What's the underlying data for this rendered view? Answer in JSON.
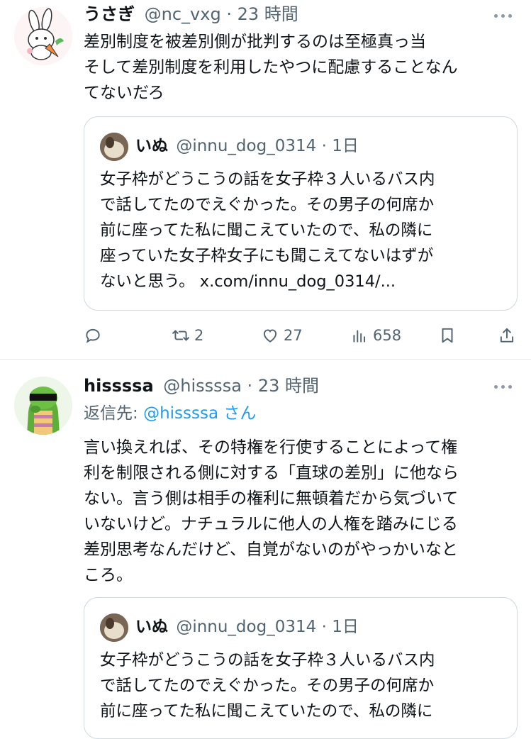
{
  "tweets": [
    {
      "author": {
        "name": "うさぎ",
        "handle": "@nc_vxg",
        "time": "23 時間"
      },
      "separator": "·",
      "text_lines": [
        "差別制度を被差別側が批判するのは至極真っ当",
        "そして差別制度を利用したやつに配慮することなん",
        "てないだろ"
      ],
      "quote": {
        "author": {
          "name": "いぬ",
          "handle": "@innu_dog_0314",
          "time": "1日"
        },
        "text_lines": [
          "女子枠がどうこうの話を女子枠３人いるバス内",
          "で話してたのでえぐかった。その男子の何席か",
          "前に座ってた私に聞こえていたので、私の隣に",
          "座っていた女子枠女子にも聞こえてないはずが",
          "ないと思う。 x.com/innu_dog_0314/..."
        ]
      },
      "actions": {
        "reply": "",
        "retweet": "2",
        "like": "27",
        "views": "658"
      }
    },
    {
      "author": {
        "name": "hissssa",
        "handle": "@hissssa",
        "time": "23 時間"
      },
      "separator": "·",
      "reply_to": {
        "prefix": "返信先: ",
        "handle": "@hissssa",
        "suffix": " さん"
      },
      "text_lines": [
        "言い換えれば、その特権を行使することによって権",
        "利を制限される側に対する「直球の差別」に他なら",
        "ない。言う側は相手の権利に無頓着だから気づいて",
        "いないけど。ナチュラルに他人の人権を踏みにじる",
        "差別思考なんだけど、自覚がないのがやっかいなと",
        "ころ。"
      ],
      "quote": {
        "author": {
          "name": "いぬ",
          "handle": "@innu_dog_0314",
          "time": "1日"
        },
        "text_lines": [
          "女子枠がどうこうの話を女子枠３人いるバス内",
          "で話してたのでえぐかった。その男子の何席か",
          "前に座ってた私に聞こえていたので、私の隣に"
        ]
      }
    }
  ]
}
